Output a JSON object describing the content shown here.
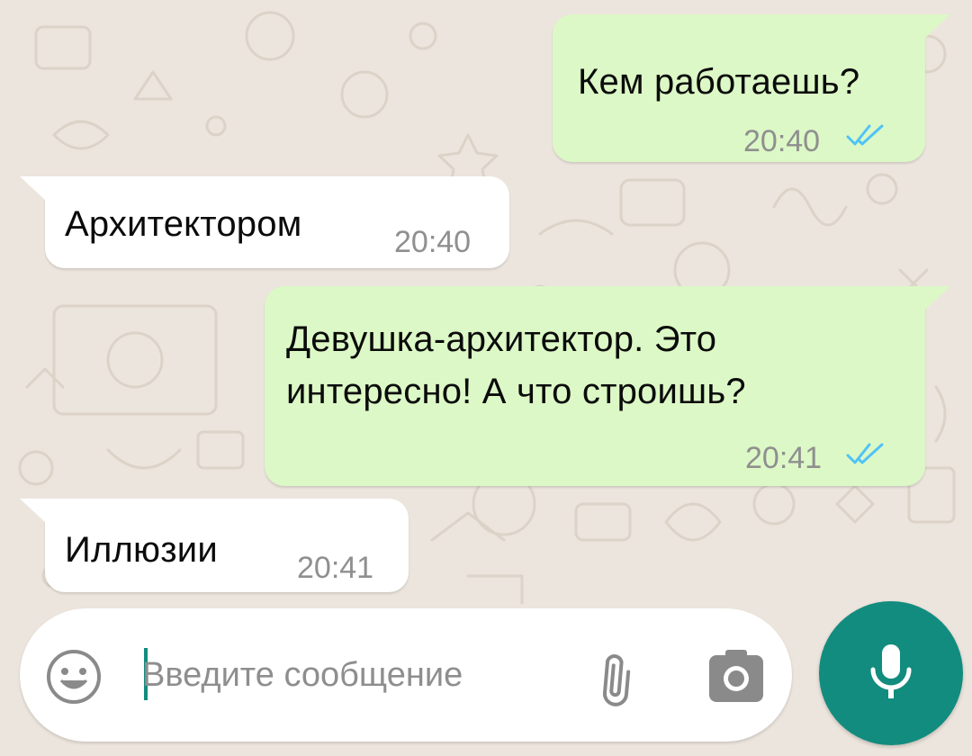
{
  "messages": [
    {
      "direction": "outgoing",
      "text_lines": [
        "Кем работаешь?"
      ],
      "time": "20:40",
      "status": "read"
    },
    {
      "direction": "incoming",
      "text_lines": [
        "Архитектором"
      ],
      "time": "20:40"
    },
    {
      "direction": "outgoing",
      "text_lines": [
        "Девушка-архитектор. Это",
        "интересно! А что строишь?"
      ],
      "time": "20:41",
      "status": "read"
    },
    {
      "direction": "incoming",
      "text_lines": [
        "Иллюзии"
      ],
      "time": "20:41"
    }
  ],
  "composer": {
    "placeholder": "Введите сообщение",
    "value": ""
  },
  "icons": {
    "emoji": "emoji-smile-icon",
    "attach": "paperclip-icon",
    "camera": "camera-icon",
    "mic": "microphone-icon",
    "read_status": "double-check-icon"
  },
  "colors": {
    "wallpaper": "#ece5dd",
    "outgoing_bubble": "#dcf8c6",
    "incoming_bubble": "#ffffff",
    "accent": "#128c7e",
    "read_ticks": "#4fc3f7",
    "timestamp": "#8f8f8f"
  }
}
